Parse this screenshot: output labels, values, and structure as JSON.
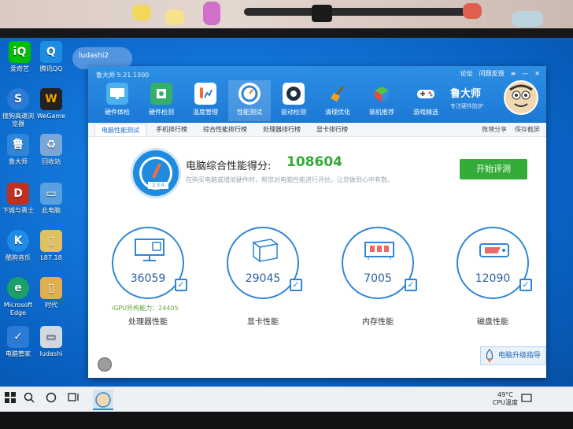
{
  "desktop": {
    "icons": [
      {
        "label": "爱奇艺",
        "glyph": "iQ",
        "color": "#00be06"
      },
      {
        "label": "腾讯QQ",
        "glyph": "Q",
        "color": "#1c8de0"
      },
      {
        "label": "搜狗高速浏览器",
        "glyph": "S",
        "color": "#2a7ad6"
      },
      {
        "label": "WeGame",
        "glyph": "W",
        "color": "#f5a300"
      },
      {
        "label": "鲁大师",
        "glyph": "鲁",
        "color": "#2f86d8"
      },
      {
        "label": "回收站",
        "glyph": "♻",
        "color": "#7aa7d6"
      },
      {
        "label": "下城与勇士",
        "glyph": "D",
        "color": "#c03020"
      },
      {
        "label": "此电脑",
        "glyph": "▭",
        "color": "#5aa0e0"
      },
      {
        "label": "酷狗音乐",
        "glyph": "K",
        "color": "#1f8cea"
      },
      {
        "label": "L87.18",
        "glyph": "▯",
        "color": "#e0c060"
      },
      {
        "label": "Microsoft Edge",
        "glyph": "e",
        "color": "#1aa06a"
      },
      {
        "label": "时代",
        "glyph": "▯",
        "color": "#e0b050"
      },
      {
        "label": "电脑管家",
        "glyph": "✓",
        "color": "#2a7ad6"
      },
      {
        "label": "ludashi",
        "glyph": "▭",
        "color": "#d0d8e0"
      }
    ],
    "qq_tag": "ludashi2"
  },
  "app": {
    "title": "鲁大师 5.21.1300",
    "window_links": [
      "论坛",
      "问题反馈",
      "≡",
      "—",
      "✕"
    ],
    "tools": [
      {
        "label": "硬件体检",
        "icon": "monitor-icon",
        "color": "#4ab0f0"
      },
      {
        "label": "硬件检测",
        "icon": "chip-icon",
        "color": "#35b06a"
      },
      {
        "label": "温度管理",
        "icon": "thermometer-icon",
        "color": "#f06a3a"
      },
      {
        "label": "性能测试",
        "icon": "gauge-icon",
        "color": "#2f86d8"
      },
      {
        "label": "驱动检测",
        "icon": "driver-icon",
        "color": "#203040"
      },
      {
        "label": "清理优化",
        "icon": "broom-icon",
        "color": "#f0a020"
      },
      {
        "label": "装机推荐",
        "icon": "cube-icon",
        "color": "#5ac040"
      },
      {
        "label": "游戏精选",
        "icon": "gamepad-icon",
        "color": "#ffffff"
      }
    ],
    "brand": {
      "name": "鲁大师",
      "slogan": "专注硬件防护"
    },
    "subtabs": [
      "电脑性能测试",
      "手机排行榜",
      "综合性能排行榜",
      "处理器排行榜",
      "显卡排行榜"
    ],
    "share": "微博分享",
    "save_screenshot": "保存截屏",
    "score_label": "电脑综合性能得分:",
    "score_value": "108604",
    "score_desc": "在购买电脑或增加硬件时，帮您对电脑性能进行评估，让您做到心中有数。",
    "dial_text": "2 3 4",
    "start_button": "开始评测",
    "components": [
      {
        "value": "36059",
        "label": "处理器性能",
        "icon": "cpu-monitor-icon"
      },
      {
        "value": "29045",
        "label": "显卡性能",
        "icon": "gpu-box-icon"
      },
      {
        "value": "7005",
        "label": "内存性能",
        "icon": "memory-icon"
      },
      {
        "value": "12090",
        "label": "磁盘性能",
        "icon": "disk-icon"
      }
    ],
    "igpu": "iGPU异构能力：24405",
    "upgrade": "电脑升级指导"
  },
  "taskbar": {
    "temp": "49°C",
    "temp_label": "CPU温度"
  }
}
